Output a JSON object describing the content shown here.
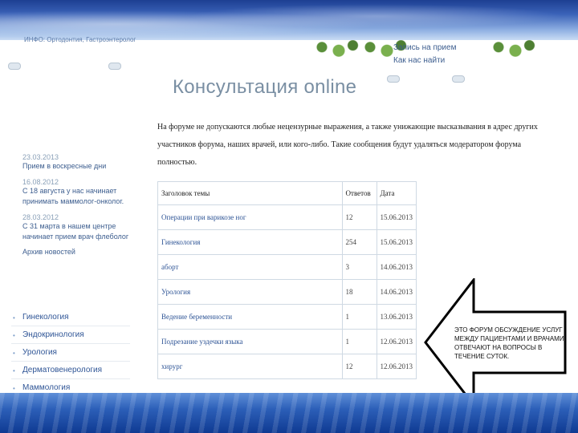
{
  "header": {
    "top_strip": "ИНФО: Ортодонтия, Гастроэнтеролог",
    "links": [
      "Запись на прием",
      "Как нас найти"
    ]
  },
  "page_title": "Консультация online",
  "notice": "На форуме не допускаются любые нецензурные выражения, а также унижающие высказывания в адрес других участников форума, наших врачей, или кого-либо. Такие сообщения будут удаляться модератором форума полностью.",
  "news": [
    {
      "date": "23.03.2013",
      "text": "Прием в воскресные дни"
    },
    {
      "date": "16.08.2012",
      "text": "С 18 августа у нас начинает принимать маммолог-онколог."
    },
    {
      "date": "28.03.2012",
      "text": "С 31 марта в нашем центре начинает прием врач флеболог"
    },
    {
      "date": "",
      "text": "Архив новостей"
    }
  ],
  "menu": [
    "Гинекология",
    "Эндокринология",
    "Урология",
    "Дерматовенерология",
    "Маммология"
  ],
  "forum": {
    "headers": {
      "topic": "Заголовок темы",
      "answers": "Ответов",
      "date": "Дата"
    },
    "rows": [
      {
        "topic": "Операции при варикозе ног",
        "answers": "12",
        "date": "15.06.2013"
      },
      {
        "topic": "Гинекология",
        "answers": "254",
        "date": "15.06.2013"
      },
      {
        "topic": "аборт",
        "answers": "3",
        "date": "14.06.2013"
      },
      {
        "topic": "Урология",
        "answers": "18",
        "date": "14.06.2013"
      },
      {
        "topic": "Ведение беременности",
        "answers": "1",
        "date": "13.06.2013"
      },
      {
        "topic": "Подрезание уздечки языка",
        "answers": "1",
        "date": "12.06.2013"
      },
      {
        "topic": "хирург",
        "answers": "12",
        "date": "12.06.2013"
      }
    ]
  },
  "callout": "ЭТО ФОРУМ ОБСУЖДЕНИЕ УСЛУГ МЕЖДУ ПАЦИЕНТАМИ И ВРАЧАМИ. ОТВЕЧАЮТ НА ВОПРОСЫ В ТЕЧЕНИЕ СУТОК.",
  "colors": {
    "link": "#2f5596",
    "title": "#7a8fa3",
    "frame_top": "#1d3f92",
    "frame_bottom": "#0f3a92"
  }
}
